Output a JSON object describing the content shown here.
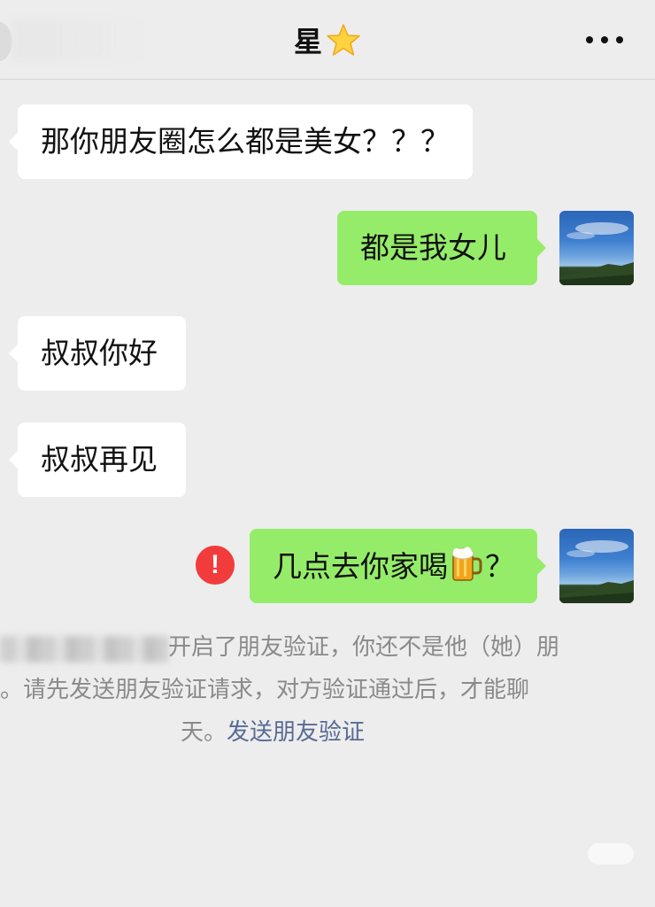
{
  "header": {
    "title": "星",
    "title_icon": "star-emoji",
    "more_icon": "more-dots-icon"
  },
  "messages": [
    {
      "side": "left",
      "text": "那你朋友圈怎么都是美女？？？"
    },
    {
      "side": "right",
      "text": "都是我女儿"
    },
    {
      "side": "left",
      "text": "叔叔你好"
    },
    {
      "side": "left",
      "text": "叔叔再见"
    },
    {
      "side": "right",
      "text_before": "几点去你家喝",
      "emoji": "beer-mug-emoji",
      "text_after": "？",
      "status": "failed"
    }
  ],
  "system_notice": {
    "line1": "开启了朋友验证，你还不是他（她）朋",
    "line2": "。请先发送朋友验证请求，对方验证通过后，才能聊",
    "line3_text": "天。",
    "link": "发送朋友验证"
  },
  "colors": {
    "background": "#ededed",
    "bubble_left": "#ffffff",
    "bubble_right": "#95ec69",
    "error_red": "#f23c3c",
    "link_blue": "#576b95",
    "notice_gray": "#8a8a8a"
  }
}
